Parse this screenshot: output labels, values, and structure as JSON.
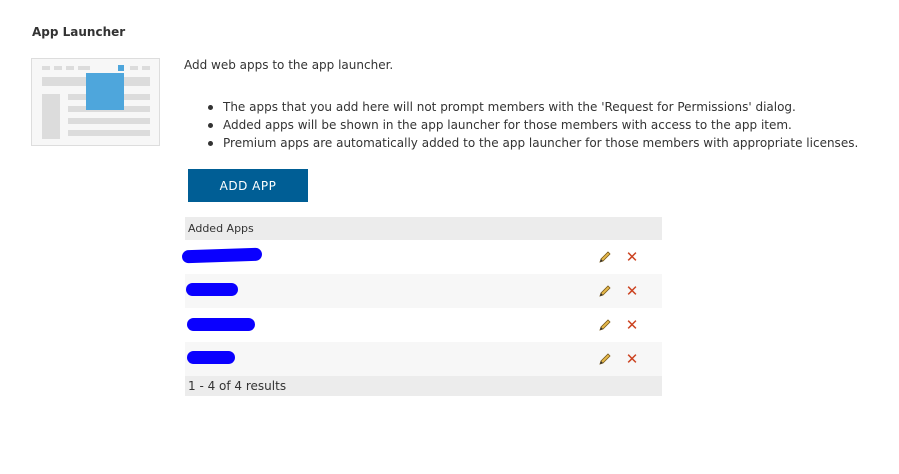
{
  "section": {
    "title": "App Launcher",
    "intro": "Add web apps to the app launcher.",
    "bullets": [
      "The apps that you add here will not prompt members with the 'Request for Permissions' dialog.",
      "Added apps will be shown in the app launcher for those members with access to the app item.",
      "Premium apps are automatically added to the app launcher for those members with appropriate licenses."
    ],
    "add_button_label": "ADD APP"
  },
  "table": {
    "header": "Added Apps",
    "rows": [
      {
        "name": "[redacted]",
        "edit_icon": "pencil-icon",
        "delete_icon": "close-icon"
      },
      {
        "name": "[redacted]",
        "edit_icon": "pencil-icon",
        "delete_icon": "close-icon"
      },
      {
        "name": "[redacted]",
        "edit_icon": "pencil-icon",
        "delete_icon": "close-icon"
      },
      {
        "name": "[redacted]",
        "edit_icon": "pencil-icon",
        "delete_icon": "close-icon"
      }
    ],
    "footer": "1 - 4 of 4 results"
  },
  "colors": {
    "button": "#005e95",
    "accent_blue": "#4ea6dc",
    "delete_red": "#cc4422",
    "redaction": "#0a00ff"
  }
}
